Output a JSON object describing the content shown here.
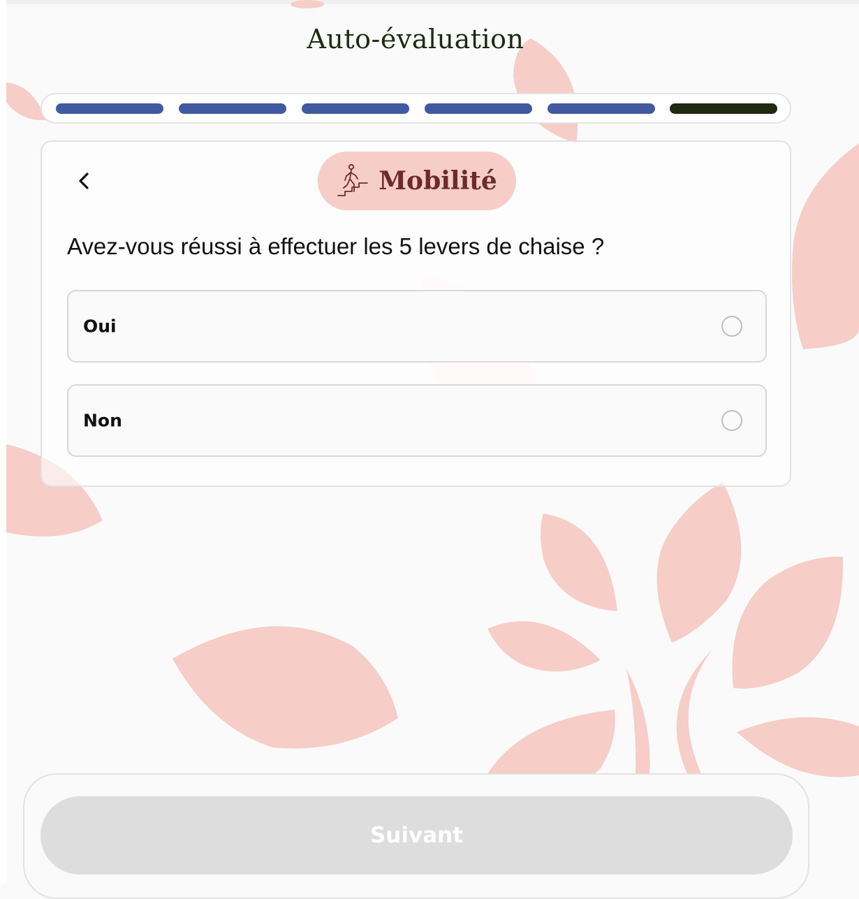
{
  "header": {
    "title": "Auto-évaluation"
  },
  "progress": {
    "total_steps": 6,
    "current_step": 6,
    "completed_color": "#4059a0",
    "current_color": "#1f2a10"
  },
  "card": {
    "back_icon": "chevron-left-icon",
    "category": {
      "label": "Mobilité",
      "icon": "stairs-climbing-person-icon",
      "background": "#f6cdc7",
      "text_color": "#6c2b2b"
    },
    "question": "Avez-vous réussi à effectuer les 5 levers de chaise ?",
    "options": [
      {
        "label": "Oui",
        "selected": false
      },
      {
        "label": "Non",
        "selected": false
      }
    ]
  },
  "footer": {
    "next_label": "Suivant",
    "next_enabled": false
  },
  "colors": {
    "background": "#fbfafa",
    "leaf": "#f6cdc7",
    "disabled_button": "#dddddd"
  }
}
